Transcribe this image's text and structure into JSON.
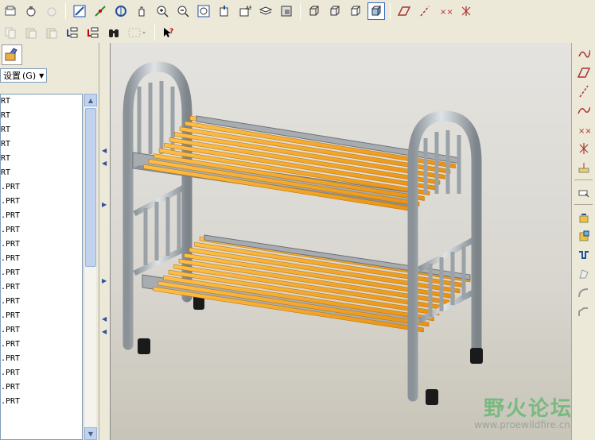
{
  "toolbar1": {
    "icons": [
      "new-file-icon",
      "open-file-icon",
      "save-icon",
      "repaint-icon",
      "spin-center-icon",
      "orient-icon",
      "pan-icon",
      "zoom-in-icon",
      "zoom-out-icon",
      "refit-icon",
      "reorient-icon",
      "named-views-icon",
      "layers-icon",
      "model-display-icon",
      "wireframe-icon",
      "hidden-line-icon",
      "no-hidden-icon",
      "shading-icon",
      "datum-planes-icon",
      "datum-axes-icon",
      "datum-points-icon",
      "coord-systems-icon"
    ]
  },
  "toolbar2": {
    "icons": [
      "copy-icon",
      "paste-icon",
      "paste-special-icon",
      "regenerate-icon",
      "regen-manager-icon",
      "binoculars-icon",
      "selection-filter-icon",
      "context-help-icon"
    ]
  },
  "left_panel": {
    "settings_label": "设置",
    "settings_hotkey": "(G)",
    "tree_items": [
      "RT",
      "RT",
      "RT",
      "RT",
      "RT",
      "RT",
      ".PRT",
      ".PRT",
      ".PRT",
      ".PRT",
      ".PRT",
      ".PRT",
      ".PRT",
      ".PRT",
      ".PRT",
      ".PRT",
      ".PRT",
      ".PRT",
      ".PRT",
      ".PRT",
      ".PRT",
      ".PRT"
    ]
  },
  "right_toolbar": {
    "icons": [
      "sketch-tool-icon",
      "plane-tool-icon",
      "axis-tool-icon",
      "curve-tool-icon",
      "point-tool-icon",
      "csys-tool-icon",
      "analysis-tool-icon",
      "sketch-insert-icon",
      "extrude-icon",
      "revolve-icon",
      "sweep-icon",
      "blend-icon",
      "round-icon",
      "chamfer-icon"
    ]
  },
  "watermark": {
    "title": "野火论坛",
    "url": "www.proewildfire.cn"
  },
  "colors": {
    "slat": "#f5a623",
    "frame": "#b9c0c6",
    "accent": "#316ac5"
  }
}
